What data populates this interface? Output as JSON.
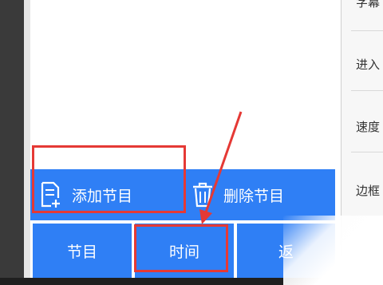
{
  "right_menu": [
    {
      "label": "字幕"
    },
    {
      "label": "进入"
    },
    {
      "label": "速度"
    },
    {
      "label": "边框"
    }
  ],
  "actions": {
    "add_program": "添加节目",
    "delete_program": "删除节目"
  },
  "tabs": [
    {
      "label": "节目"
    },
    {
      "label": "时间"
    },
    {
      "label": "返"
    }
  ],
  "colors": {
    "accent": "#2f7ff5",
    "highlight": "#e53935"
  },
  "icons": {
    "add_program": "document-plus-icon",
    "delete_program": "trash-icon"
  }
}
